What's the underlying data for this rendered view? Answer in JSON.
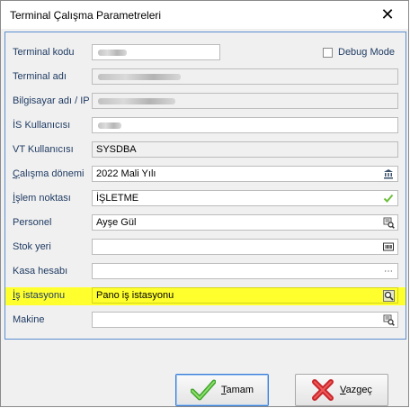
{
  "window": {
    "title": "Terminal Çalışma Parametreleri",
    "close_symbol": "✕"
  },
  "debug": {
    "label": "Debug Mode",
    "checked": false
  },
  "fields": [
    {
      "key": "terminal_kodu",
      "label": "Terminal kodu",
      "value": "",
      "icon": null,
      "readonly": false,
      "blurred": true
    },
    {
      "key": "terminal_adi",
      "label": "Terminal adı",
      "value": "",
      "icon": null,
      "readonly": true,
      "blurred": true
    },
    {
      "key": "bilgisayar_adi",
      "label": "Bilgisayar adı / IP",
      "value": "",
      "icon": null,
      "readonly": true,
      "blurred": true
    },
    {
      "key": "is_kullanicisi",
      "label": "İS Kullanıcısı",
      "value": "",
      "icon": null,
      "readonly": false,
      "blurred": true
    },
    {
      "key": "vt_kullanicisi",
      "label": "VT Kullanıcısı",
      "value": "SYSDBA",
      "icon": null,
      "readonly": true,
      "blurred": false
    },
    {
      "key": "calisma_donemi",
      "label": "Çalışma dönemi",
      "value": "2022 Mali Yılı",
      "icon": "bank-icon",
      "readonly": false,
      "blurred": false
    },
    {
      "key": "islem_noktasi",
      "label": "İşlem noktası",
      "value": "İŞLETME",
      "icon": "checkmark-icon",
      "readonly": false,
      "blurred": false
    },
    {
      "key": "personel",
      "label": "Personel",
      "value": "Ayşe Gül",
      "icon": "search-list-icon",
      "readonly": false,
      "blurred": false
    },
    {
      "key": "stok_yeri",
      "label": "Stok yeri",
      "value": "",
      "icon": "barcode-icon",
      "readonly": false,
      "blurred": false
    },
    {
      "key": "kasa_hesabi",
      "label": "Kasa hesabı",
      "value": "",
      "icon": "ellipsis-icon",
      "readonly": false,
      "blurred": false
    },
    {
      "key": "is_istasyonu",
      "label": "İş istasyonu",
      "value": "Pano iş istasyonu",
      "icon": "magnifier-icon",
      "readonly": false,
      "blurred": false,
      "highlighted": true
    },
    {
      "key": "makine",
      "label": "Makine",
      "value": "",
      "icon": "search-list-icon",
      "readonly": false,
      "blurred": false
    }
  ],
  "buttons": {
    "ok": {
      "mnemonic": "T",
      "rest": "amam",
      "icon": "green-check-icon"
    },
    "cancel": {
      "mnemonic": "V",
      "rest": "azgeç",
      "icon": "red-x-icon"
    }
  },
  "colors": {
    "highlight": "#ffff2e",
    "label_text": "#1f3b63",
    "panel_border": "#5a8fd0"
  }
}
